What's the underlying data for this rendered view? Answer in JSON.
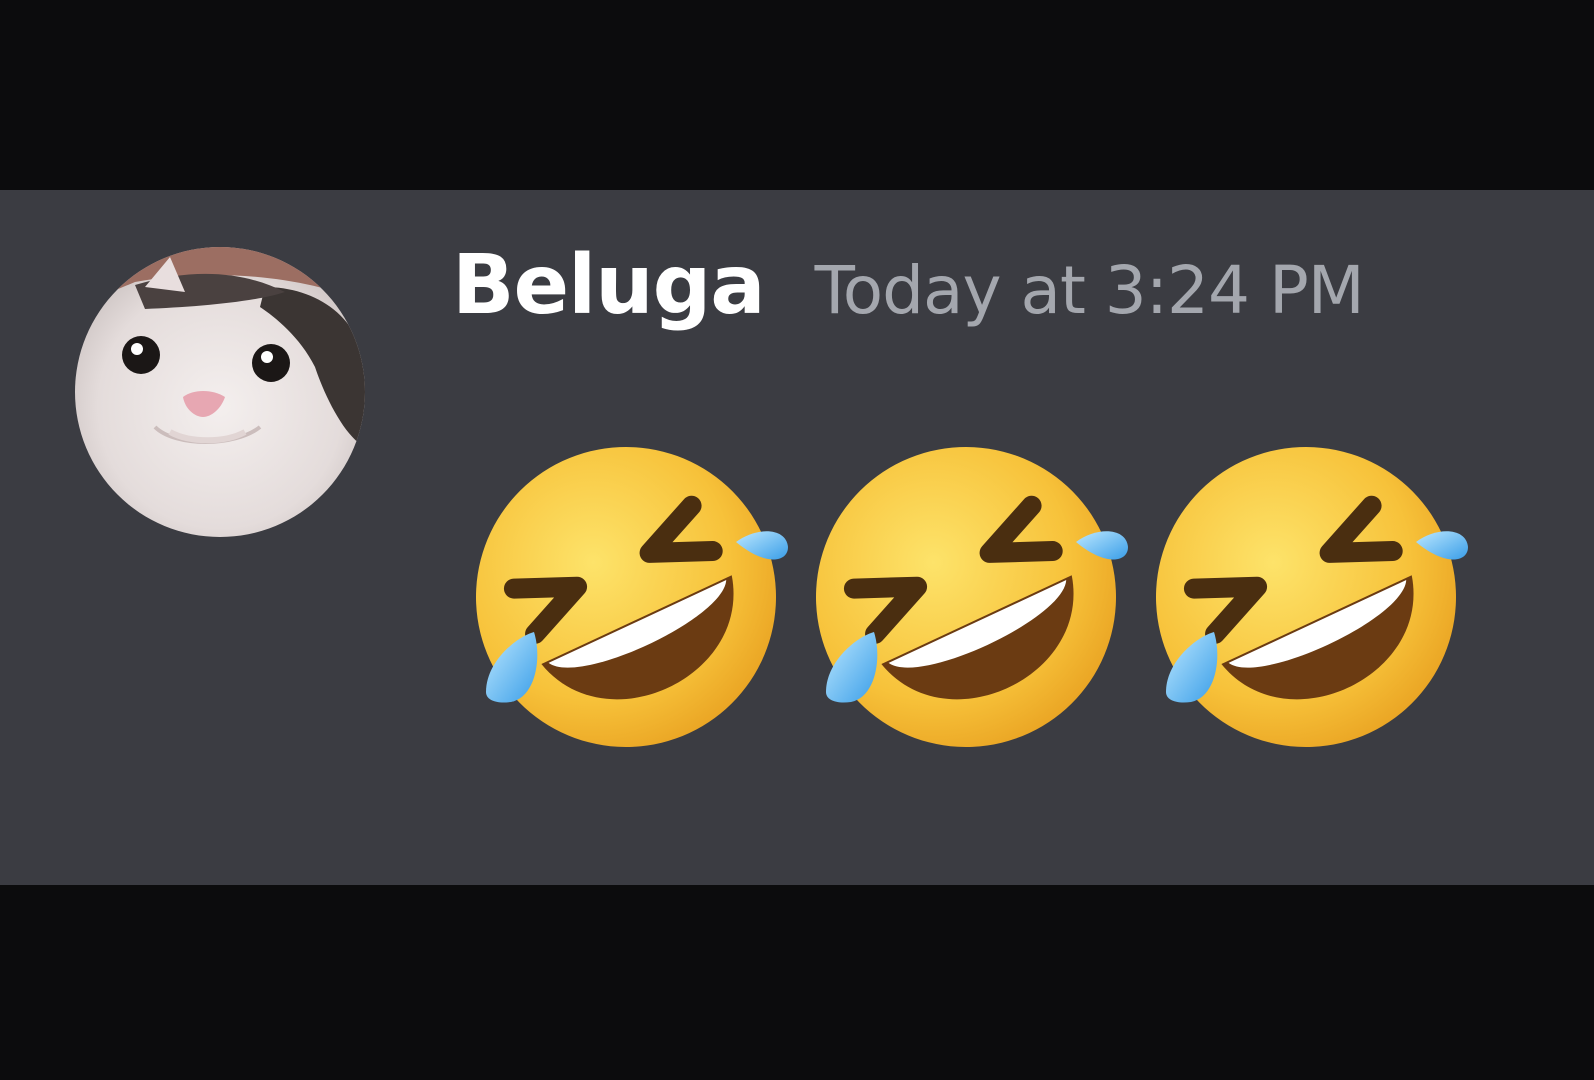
{
  "message": {
    "author": "Beluga",
    "timestamp": "Today at 3:24 PM",
    "avatar_icon": "beluga-cat-avatar",
    "content_emojis": [
      {
        "icon": "rolling-on-the-floor-laughing-emoji"
      },
      {
        "icon": "rolling-on-the-floor-laughing-emoji"
      },
      {
        "icon": "rolling-on-the-floor-laughing-emoji"
      }
    ]
  },
  "colors": {
    "background": "#0c0c0d",
    "message_background": "#3b3c42",
    "username": "#ffffff",
    "timestamp": "#a4a7ae"
  }
}
